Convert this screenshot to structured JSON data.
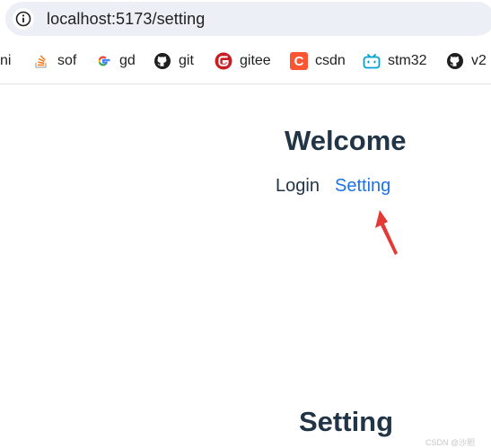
{
  "browser": {
    "url": "localhost:5173/setting",
    "bookmarks": [
      {
        "label": "ni",
        "icon": "none"
      },
      {
        "label": "sof",
        "icon": "stackoverflow-icon"
      },
      {
        "label": "gd",
        "icon": "google-icon"
      },
      {
        "label": "git",
        "icon": "github-icon"
      },
      {
        "label": "gitee",
        "icon": "gitee-icon"
      },
      {
        "label": "csdn",
        "icon": "csdn-icon"
      },
      {
        "label": "stm32",
        "icon": "bilibili-icon"
      },
      {
        "label": "v2",
        "icon": "github-icon"
      }
    ]
  },
  "page": {
    "heading": "Welcome",
    "nav": {
      "login": "Login",
      "setting": "Setting"
    },
    "view_heading": "Setting"
  },
  "watermark": "CSDN @沙胆",
  "colors": {
    "heading": "#213547",
    "link": "#1a73e8",
    "arrow": "#e53935"
  }
}
